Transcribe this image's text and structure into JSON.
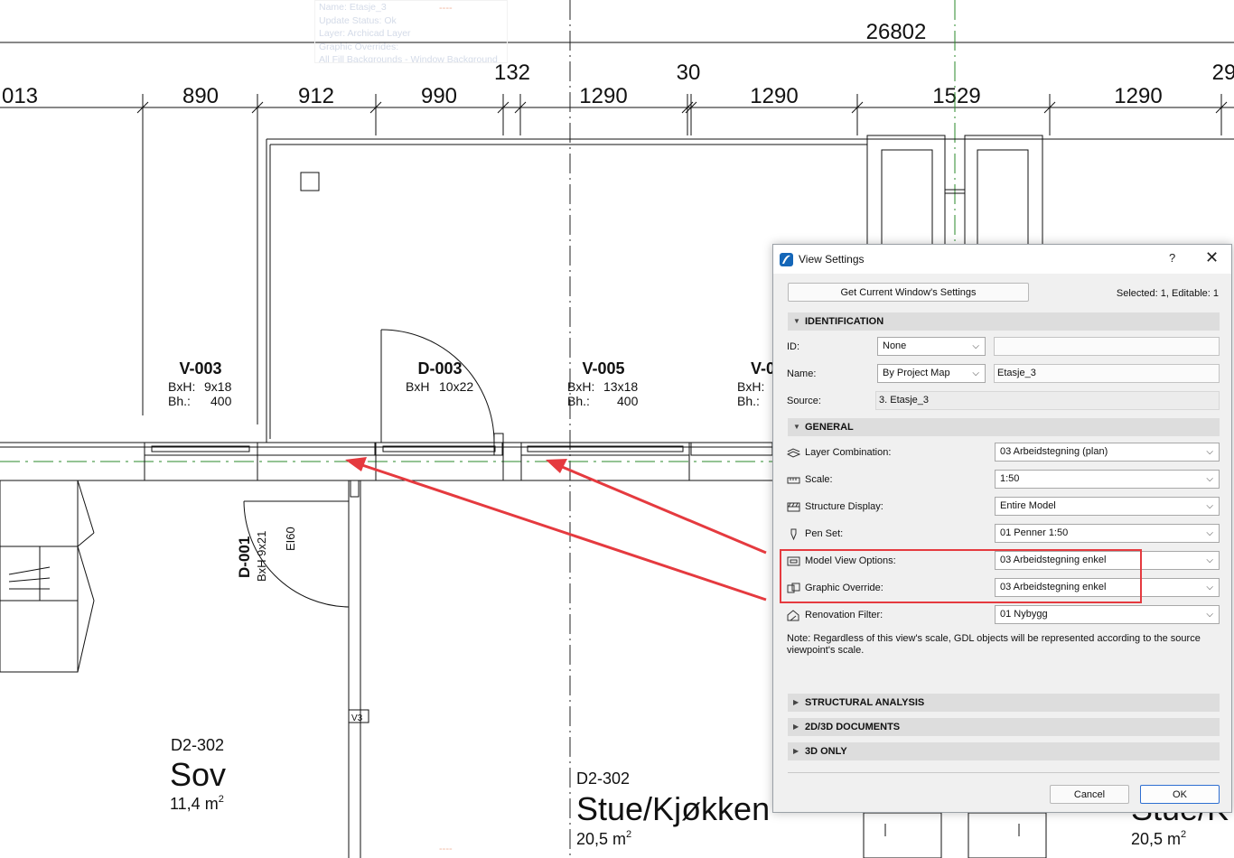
{
  "plan": {
    "dims_top": {
      "overall": "26802",
      "mid_132": "132",
      "mid_30": "30",
      "mid_29": "29"
    },
    "dims": [
      "013",
      "890",
      "912",
      "990",
      "1290",
      "1290",
      "1529",
      "1290"
    ],
    "openings": [
      {
        "id": "V-003",
        "bxh_label": "BxH:",
        "bxh_value": "9x18",
        "bh_label": "Bh.:",
        "bh_value": "400"
      },
      {
        "id": "D-003",
        "bxh_label": "BxH",
        "bxh_value": "10x22"
      },
      {
        "id": "V-005",
        "bxh_label": "BxH:",
        "bxh_value": "13x18",
        "bh_label": "Bh.:",
        "bh_value": "400"
      },
      {
        "id": "V-0",
        "bxh_label": "BxH:",
        "bh_label": "Bh.:"
      }
    ],
    "door_d001": {
      "id": "D-001",
      "bxh": "BxH 9x21",
      "rating": "EI60"
    },
    "marker_v3": "V3",
    "rooms": [
      {
        "number": "D2-302",
        "name": "Sov",
        "area": "11,4 m",
        "sup": "2"
      },
      {
        "number": "D2-302",
        "name": "Stue/Kjøkken",
        "area": "20,5 m",
        "sup": "2"
      },
      {
        "name": "Stue/K",
        "area": "20,5 m",
        "sup": "2"
      }
    ],
    "tooltip_lines": [
      "Name: Etasje_3",
      "Update Status: Ok",
      "Layer: Archicad Layer",
      "Graphic Overrides:",
      "All Fill Backgrounds - Window Background"
    ],
    "ghost_dash": "----"
  },
  "dialog": {
    "title": "View Settings",
    "help": "?",
    "close": "✕",
    "get_settings_label": "Get Current Window's Settings",
    "selected_info": "Selected: 1, Editable: 1",
    "identification": {
      "header": "IDENTIFICATION",
      "id_label": "ID:",
      "id_value": "None",
      "id_text": "",
      "name_label": "Name:",
      "name_value": "By Project Map",
      "name_text": "Etasje_3",
      "source_label": "Source:",
      "source_value": "3. Etasje_3"
    },
    "general": {
      "header": "GENERAL",
      "rows": [
        {
          "label": "Layer Combination:",
          "value": "03 Arbeidstegning (plan)",
          "icon": "layers-icon"
        },
        {
          "label": "Scale:",
          "value": "1:50",
          "icon": "scale-ruler-icon"
        },
        {
          "label": "Structure Display:",
          "value": "Entire Model",
          "icon": "structure-display-icon"
        },
        {
          "label": "Pen Set:",
          "value": "01 Penner 1:50",
          "icon": "pen-icon"
        },
        {
          "label": "Model View Options:",
          "value": "03 Arbeidstegning enkel",
          "icon": "model-view-icon"
        },
        {
          "label": "Graphic Override:",
          "value": "03 Arbeidstegning enkel",
          "icon": "graphic-override-icon"
        },
        {
          "label": "Renovation Filter:",
          "value": "01 Nybygg",
          "icon": "renovation-icon"
        }
      ],
      "note": "Note: Regardless of this view's scale, GDL objects will be represented according to the source viewpoint's scale."
    },
    "collapsed_sections": [
      "STRUCTURAL ANALYSIS",
      "2D/3D DOCUMENTS",
      "3D ONLY"
    ],
    "cancel_label": "Cancel",
    "ok_label": "OK"
  },
  "colors": {
    "annotation_red": "#e53a3f",
    "accent_blue": "#2f6fd1",
    "axis_green": "#2a8a2a"
  }
}
